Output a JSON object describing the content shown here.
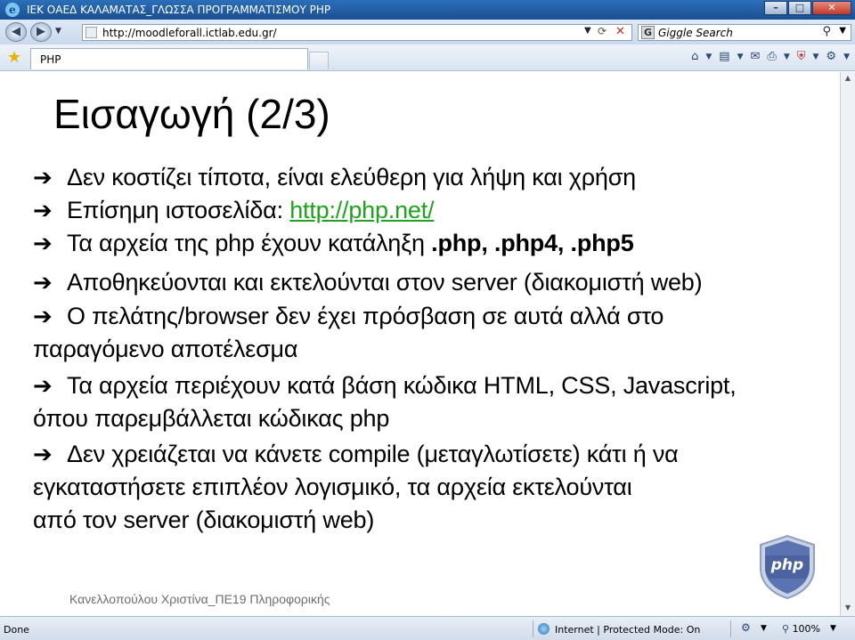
{
  "window": {
    "title": "ΙΕΚ ΟΑΕΔ ΚΑΛΑΜΑΤΑΣ_ΓΛΩΣΣΑ ΠΡΟΓΡΑΜΜΑΤΙΣΜΟΥ PHP",
    "minimize": "–",
    "maximize": "□",
    "close": "✕"
  },
  "address_bar": {
    "url": "http://moodleforall.ictlab.edu.gr/"
  },
  "search": {
    "placeholder": "Giggle Search"
  },
  "tab": {
    "label": "PHP"
  },
  "slide": {
    "title": "Εισαγωγή (2/3)",
    "arrow": "➔",
    "bullets": {
      "b1": "Δεν κοστίζει τίποτα, είναι ελεύθερη για λήψη και χρήση",
      "b2_prefix": "Επίσημη ιστοσελίδα: ",
      "b2_link": "http://php.net/",
      "b3_prefix": "Τα αρχεία της php έχουν κατάληξη ",
      "b3_bold": ".php, .php4, .php5",
      "b4": "Αποθηκεύονται και εκτελούνται στον server (διακομιστή web)",
      "b5_line1": "Ο πελάτης/browser δεν έχει πρόσβαση σε αυτά αλλά στο",
      "b5_line2": "παραγόμενο αποτέλεσμα",
      "b6_line1": "Τα αρχεία περιέχουν κατά βάση κώδικα HTML, CSS, Javascript,",
      "b6_line2": "όπου παρεμβάλλεται κώδικας php",
      "b7_line1": "Δεν χρειάζεται να κάνετε compile (μεταγλωτίσετε) κάτι ή να",
      "b7_line2": "εγκαταστήσετε επιπλέον λογισμικό, τα αρχεία εκτελούνται",
      "b7_line3": "από τον server (διακομιστή web)"
    },
    "footer": "Κανελλοπούλου Χριστίνα_ΠΕ19 Πληροφορικής",
    "logo_text": "php"
  },
  "status_bar": {
    "done": "Done",
    "zone": "Internet | Protected Mode: On",
    "zoom": "100%"
  }
}
